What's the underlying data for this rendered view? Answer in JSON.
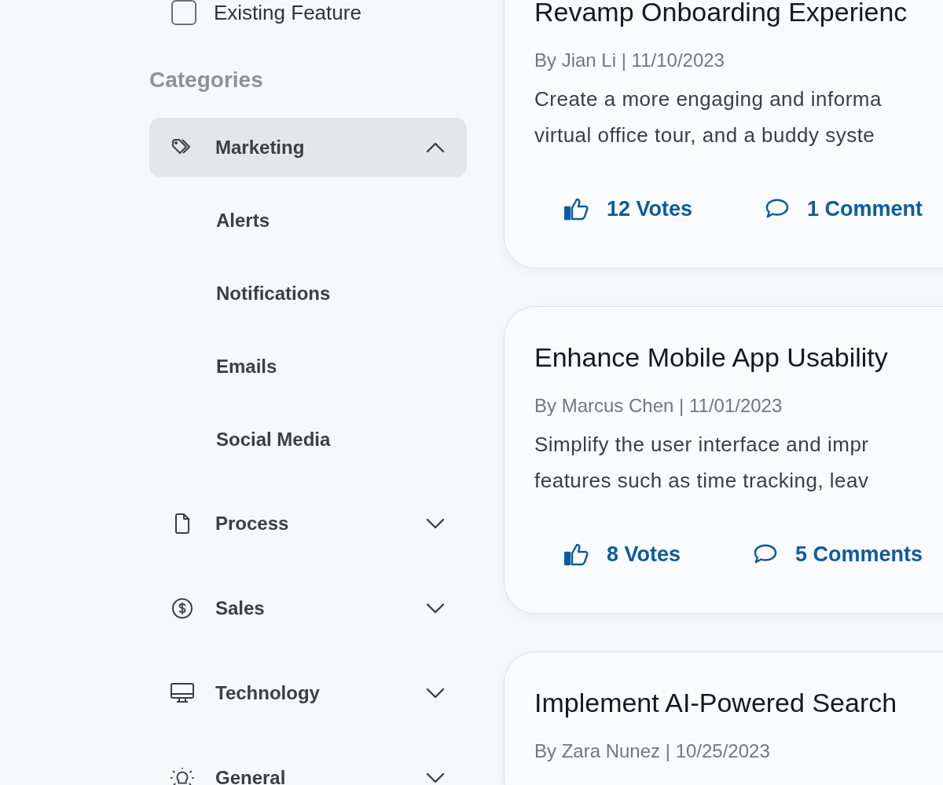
{
  "filters": [
    {
      "label": "Existing Feature",
      "checked": false
    }
  ],
  "categories": {
    "title": "Categories",
    "items": [
      {
        "label": "Marketing",
        "kind": "tag",
        "selected": true,
        "expanded": true,
        "children": [
          {
            "label": "Alerts",
            "selected": false
          },
          {
            "label": "Notifications",
            "selected": false
          },
          {
            "label": "Emails",
            "selected": false
          },
          {
            "label": "Social Media",
            "selected": false
          }
        ]
      },
      {
        "label": "Process",
        "kind": "document",
        "selected": false,
        "expanded": false
      },
      {
        "label": "Sales",
        "kind": "dollar",
        "selected": false,
        "expanded": false
      },
      {
        "label": "Technology",
        "kind": "monitor",
        "selected": false,
        "expanded": false
      },
      {
        "label": "General",
        "kind": "bulb",
        "selected": false,
        "expanded": false
      }
    ]
  },
  "posts": [
    {
      "title": "Revamp Onboarding Experienc",
      "byline": "By Jian Li | 11/10/2023",
      "description": [
        "Create a more engaging and informa",
        "virtual office tour, and a buddy syste"
      ],
      "votes": "12 Votes",
      "comments": "1 Comment"
    },
    {
      "title": "Enhance Mobile App Usability",
      "byline": "By Marcus Chen | 11/01/2023",
      "description": [
        "Simplify the user interface and impr",
        "features such as time tracking, leav"
      ],
      "votes": "8 Votes",
      "comments": "5 Comments"
    },
    {
      "title": "Implement AI-Powered Search",
      "byline": "By Zara Nunez | 10/25/2023"
    }
  ]
}
